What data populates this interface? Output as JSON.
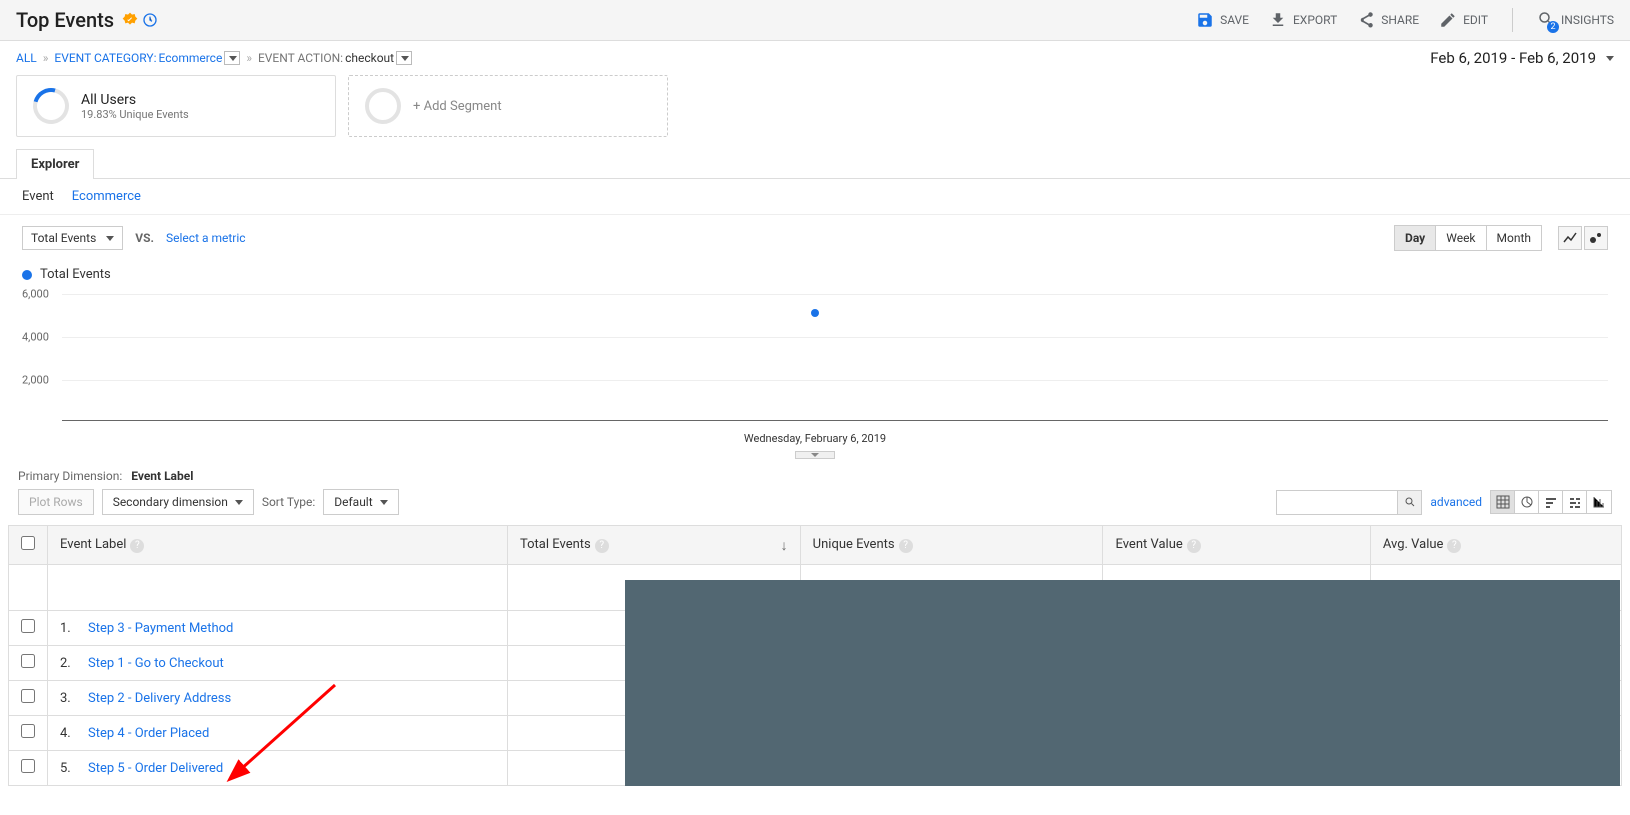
{
  "header": {
    "title": "Top Events",
    "actions": {
      "save": "SAVE",
      "export": "EXPORT",
      "share": "SHARE",
      "edit": "EDIT",
      "insights": "INSIGHTS",
      "insights_badge": "2"
    }
  },
  "breadcrumb": {
    "all": "ALL",
    "cat_label": "EVENT CATEGORY:",
    "cat_value": "Ecommerce",
    "action_label": "EVENT ACTION:",
    "action_value": "checkout"
  },
  "date_range": "Feb 6, 2019 - Feb 6, 2019",
  "segments": {
    "primary": {
      "title": "All Users",
      "sub": "19.83% Unique Events"
    },
    "add": "+ Add Segment"
  },
  "tabs": {
    "explorer": "Explorer"
  },
  "subtabs": {
    "event": "Event",
    "ecommerce": "Ecommerce"
  },
  "metric_row": {
    "metric": "Total Events",
    "vs": "VS.",
    "select": "Select a metric",
    "day": "Day",
    "week": "Week",
    "month": "Month"
  },
  "chart_data": {
    "type": "scatter",
    "legend": "Total Events",
    "yticks": [
      "2,000",
      "4,000",
      "6,000"
    ],
    "ylim": [
      0,
      6500
    ],
    "x_label": "Wednesday, February 6, 2019",
    "points": [
      {
        "x": 0.5,
        "y": 5100
      }
    ]
  },
  "primary_dimension": {
    "label": "Primary Dimension:",
    "value": "Event Label"
  },
  "toolbar": {
    "plot_rows": "Plot Rows",
    "secondary": "Secondary dimension",
    "sort_type": "Sort Type:",
    "sort_default": "Default",
    "advanced": "advanced"
  },
  "table": {
    "columns": {
      "event_label": "Event Label",
      "total_events": "Total Events",
      "unique_events": "Unique Events",
      "event_value": "Event Value",
      "avg_value": "Avg. Value"
    },
    "rows": [
      {
        "n": "1.",
        "label": "Step 3 - Payment Method"
      },
      {
        "n": "2.",
        "label": "Step 1 - Go to Checkout"
      },
      {
        "n": "3.",
        "label": "Step 2 - Delivery Address"
      },
      {
        "n": "4.",
        "label": "Step 4 - Order Placed"
      },
      {
        "n": "5.",
        "label": "Step 5 - Order Delivered"
      }
    ]
  }
}
